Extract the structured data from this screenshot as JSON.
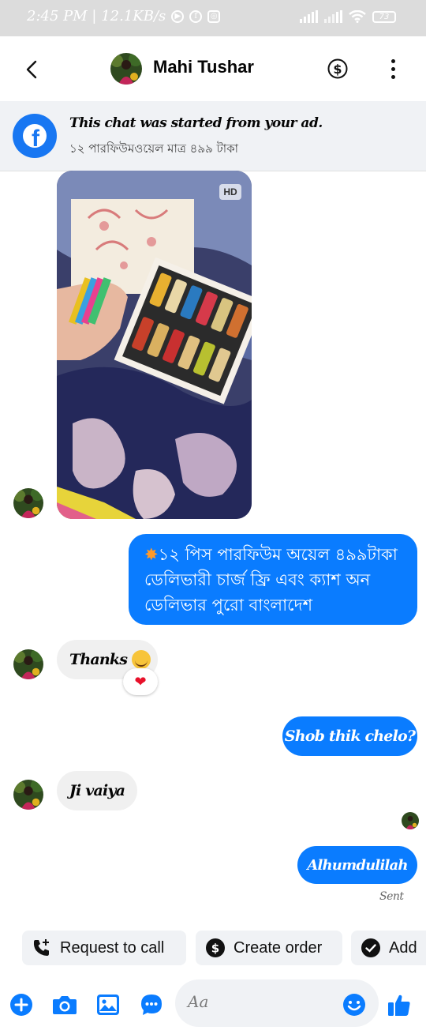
{
  "status_bar": {
    "time_speed": "2:45 PM | 12.1KB/s",
    "battery": "73"
  },
  "header": {
    "contact_name": "Mahi Tushar"
  },
  "ad_banner": {
    "title": "This chat was started from your ad.",
    "subtitle": "১২ পারফিউমওয়েল মাত্র ৪৯৯ টাকা"
  },
  "photo": {
    "hd_badge": "HD"
  },
  "messages": [
    {
      "direction": "out",
      "lines": [
        "১২ পিস পারফিউম অয়েল ৪৯৯টাকা",
        "ডেলিভারী চার্জ ফ্রি  এবং ক্যাশ অন",
        "ডেলিভার পুরো বাংলাদেশ"
      ]
    },
    {
      "direction": "in",
      "text": "Thanks",
      "reaction": "❤"
    },
    {
      "direction": "out",
      "text": "Shob thik chelo?"
    },
    {
      "direction": "in",
      "text": "Ji vaiya"
    },
    {
      "direction": "out",
      "text": "Alhumdulilah"
    }
  ],
  "sent_status": "Sent",
  "quick_actions": {
    "request_call": "Request to call",
    "create_order": "Create order",
    "add": "Add"
  },
  "composer": {
    "placeholder": "Aa"
  },
  "colors": {
    "messenger_blue": "#0a7cff",
    "facebook_blue": "#1877f2",
    "bubble_gray": "#f0f0f0"
  },
  "icons": [
    "back-arrow-icon",
    "dollar-icon",
    "more-icon",
    "facebook-icon",
    "phone-plus-icon",
    "plus-icon",
    "camera-icon",
    "gallery-icon",
    "chat-bubble-icon",
    "emoji-icon",
    "like-icon"
  ]
}
